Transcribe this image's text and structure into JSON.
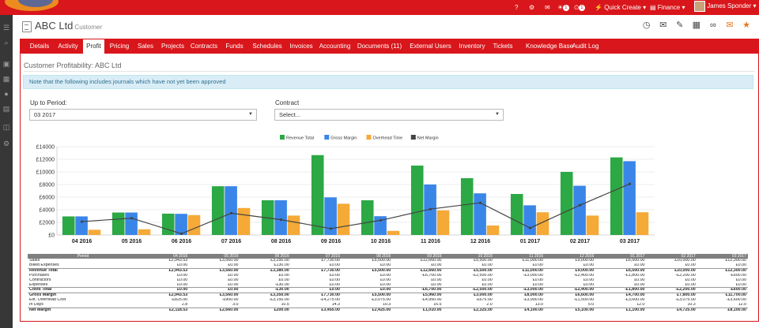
{
  "topbar": {
    "notif_count_1": "1",
    "notif_count_2": "1",
    "quick_create": "Quick Create",
    "finance": "Finance",
    "user": "James Sponder"
  },
  "header": {
    "company": "ABC Ltd",
    "company_type": "Customer"
  },
  "tabs": [
    "Details",
    "Activity",
    "Profit",
    "Pricing",
    "Sales",
    "Projects",
    "Contracts",
    "Funds",
    "Schedules",
    "Invoices",
    "Accounting",
    "Documents (11)",
    "External Users",
    "Inventory",
    "Tickets",
    "Knowledge Base",
    "Audit Log"
  ],
  "active_tab": "Profit",
  "page": {
    "title": "Customer Profitability: ABC Ltd",
    "alert": "Note that the following includes journals which have not yet been approved",
    "period_label": "Up to Period:",
    "period_value": "03 2017",
    "contract_label": "Contract",
    "contract_value": "Select..."
  },
  "colors": {
    "brand": "#d9161b",
    "revenue": "#2ca845",
    "gross": "#3a86e8",
    "overhead": "#f5a937",
    "net": "#444444"
  },
  "chart_data": {
    "type": "bar",
    "categories": [
      "04 2016",
      "05 2016",
      "06 2016",
      "07 2016",
      "08 2016",
      "09 2016",
      "10 2016",
      "11 2016",
      "12 2016",
      "01 2017",
      "02 2017",
      "03 2017"
    ],
    "series": [
      {
        "name": "Revenue Total",
        "type": "bar",
        "values": [
          2943.53,
          3560,
          3380,
          7730,
          5500,
          12660,
          5500,
          11000,
          9000,
          6500,
          10000,
          12300
        ]
      },
      {
        "name": "Gross Margin",
        "type": "bar",
        "values": [
          2943.53,
          3560,
          3350,
          7730,
          5500,
          5960,
          2975,
          8000,
          6600,
          4700,
          7800,
          11700
        ]
      },
      {
        "name": "Overhead Time",
        "type": "bar",
        "values": [
          825,
          900,
          3150,
          4275,
          3075,
          4950,
          650,
          3900,
          1500,
          3600,
          3075,
          3600
        ]
      },
      {
        "name": "Net Margin",
        "type": "line",
        "values": [
          2118.53,
          2660,
          200,
          3455,
          2425,
          1010,
          2325,
          4100,
          5100,
          1100,
          4725,
          8100
        ]
      }
    ],
    "ylim": [
      0,
      14000
    ],
    "yticks": [
      "£0",
      "£2000",
      "£4000",
      "£6000",
      "£8000",
      "£10000",
      "£12000",
      "£14000"
    ],
    "grid": true,
    "legend": "top-center"
  },
  "table": {
    "headers": [
      "Period",
      "04 2016",
      "05 2016",
      "06 2016",
      "07 2016",
      "08 2016",
      "09 2016",
      "10 2016",
      "11 2016",
      "12 2016",
      "01 2017",
      "02 2017",
      "03 2017"
    ],
    "rows": [
      {
        "label": "Sales",
        "bold": false,
        "values": [
          "£2,943.53",
          "£3,560.00",
          "£3,250.00",
          "£7,730.00",
          "£5,500.00",
          "£12,660.00",
          "£5,500.00",
          "£11,000.00",
          "£9,000.00",
          "£6,500.00",
          "£10,000.00",
          "£12,300.00"
        ]
      },
      {
        "label": "Billed Expenses",
        "bold": false,
        "values": [
          "£0.00",
          "£0.00",
          "£130.00",
          "£0.00",
          "£0.00",
          "£0.00",
          "£0.00",
          "£0.00",
          "£0.00",
          "£0.00",
          "£0.00",
          "£0.00"
        ]
      },
      {
        "label": "Revenue Total",
        "bold": true,
        "values": [
          "£2,943.53",
          "£3,560.00",
          "£3,380.00",
          "£7,730.00",
          "£5,500.00",
          "£12,660.00",
          "£5,500.00",
          "£11,000.00",
          "£9,000.00",
          "£6,500.00",
          "£10,000.00",
          "£12,300.00"
        ]
      },
      {
        "label": "Purchases",
        "bold": false,
        "values": [
          "£0.00",
          "£0.00",
          "£0.00",
          "£0.00",
          "£0.00",
          "-£6,700.00",
          "-£2,500.00",
          "-£3,000.00",
          "-£2,400.00",
          "-£1,800.00",
          "-£2,200.00",
          "-£600.00"
        ]
      },
      {
        "label": "Contractors",
        "bold": false,
        "values": [
          "£0.00",
          "£0.00",
          "£0.00",
          "£0.00",
          "£0.00",
          "£0.00",
          "£0.00",
          "£0.00",
          "£0.00",
          "£0.00",
          "£0.00",
          "£0.00"
        ]
      },
      {
        "label": "Expenses",
        "bold": false,
        "values": [
          "£0.00",
          "£0.00",
          "-£30.00",
          "£0.00",
          "£0.00",
          "£0.00",
          "£0.00",
          "£0.00",
          "£0.00",
          "£0.00",
          "£0.00",
          "£0.00"
        ]
      },
      {
        "label": "Costs Total",
        "bold": true,
        "values": [
          "£0.00",
          "£0.00",
          "-£30.00",
          "£0.00",
          "£0.00",
          "-£6,700.00",
          "-£2,500.00",
          "-£3,000.00",
          "-£2,400.00",
          "-£1,800.00",
          "-£2,200.00",
          "-£600.00"
        ]
      },
      {
        "label": "Gross Margin",
        "bold": true,
        "values": [
          "£2,943.53",
          "£3,560.00",
          "£3,350.00",
          "£7,730.00",
          "£5,500.00",
          "£5,960.00",
          "£3,000.00",
          "£8,000.00",
          "£6,600.00",
          "£4,700.00",
          "£7,800.00",
          "£11,700.00"
        ]
      },
      {
        "label": "Est. Overhead Cost",
        "bold": false,
        "values": [
          "-£825.00",
          "-£900.00",
          "-£3,150.00",
          "-£4,275.00",
          "-£3,075.00",
          "-£4,950.00",
          "-£675.00",
          "-£3,900.00",
          "-£1,500.00",
          "-£3,600.00",
          "-£3,075.00",
          "-£3,600.00"
        ]
      },
      {
        "label": "In Days",
        "bold": false,
        "values": [
          "2.8",
          "3.0",
          "10.5",
          "14.3",
          "10.3",
          "16.5",
          "2.0",
          "13.0",
          "5.0",
          "12.0",
          "10.3",
          "12.0"
        ]
      },
      {
        "label": "Net Margin",
        "bold": true,
        "values": [
          "£2,118.53",
          "£2,660.00",
          "£200.00",
          "£3,455.00",
          "£2,425.00",
          "£1,010.00",
          "£2,325.00",
          "£4,100.00",
          "£5,100.00",
          "£1,100.00",
          "£4,725.00",
          "£8,100.00"
        ]
      }
    ]
  }
}
